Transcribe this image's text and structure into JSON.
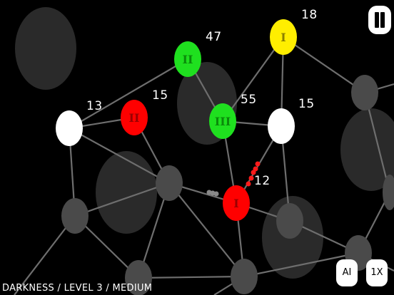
{
  "status_text": "DARKNESS / LEVEL 3 / MEDIUM",
  "controls": {
    "ai_label": "AI",
    "speed_label": "1X"
  },
  "colors": {
    "background": "#000000",
    "green": "#1fe01f",
    "red": "#ff0000",
    "yellow": "#ffee00",
    "white": "#ffffff",
    "neutral": "#4a4a4a",
    "fog": "#2c2c2c",
    "link": "#707070"
  },
  "nodes": [
    {
      "id": "g47",
      "owner": "green",
      "rank": "II",
      "count": "47"
    },
    {
      "id": "y18",
      "owner": "yellow",
      "rank": "I",
      "count": "18"
    },
    {
      "id": "r15",
      "owner": "red",
      "rank": "II",
      "count": "15"
    },
    {
      "id": "w13",
      "owner": "white",
      "rank": "",
      "count": "13"
    },
    {
      "id": "g55",
      "owner": "green",
      "rank": "III",
      "count": "55"
    },
    {
      "id": "w15",
      "owner": "white",
      "rank": "",
      "count": "15"
    },
    {
      "id": "r12",
      "owner": "red",
      "rank": "I",
      "count": "12"
    },
    {
      "id": "n1",
      "owner": "neutral",
      "rank": "",
      "count": ""
    },
    {
      "id": "n2",
      "owner": "neutral",
      "rank": "",
      "count": ""
    },
    {
      "id": "n3",
      "owner": "neutral",
      "rank": "",
      "count": ""
    },
    {
      "id": "n4",
      "owner": "neutral",
      "rank": "",
      "count": ""
    },
    {
      "id": "n5",
      "owner": "neutral",
      "rank": "",
      "count": ""
    },
    {
      "id": "n6",
      "owner": "neutral",
      "rank": "",
      "count": ""
    },
    {
      "id": "n7",
      "owner": "neutral",
      "rank": "",
      "count": ""
    },
    {
      "id": "n8",
      "owner": "neutral",
      "rank": "",
      "count": ""
    }
  ]
}
